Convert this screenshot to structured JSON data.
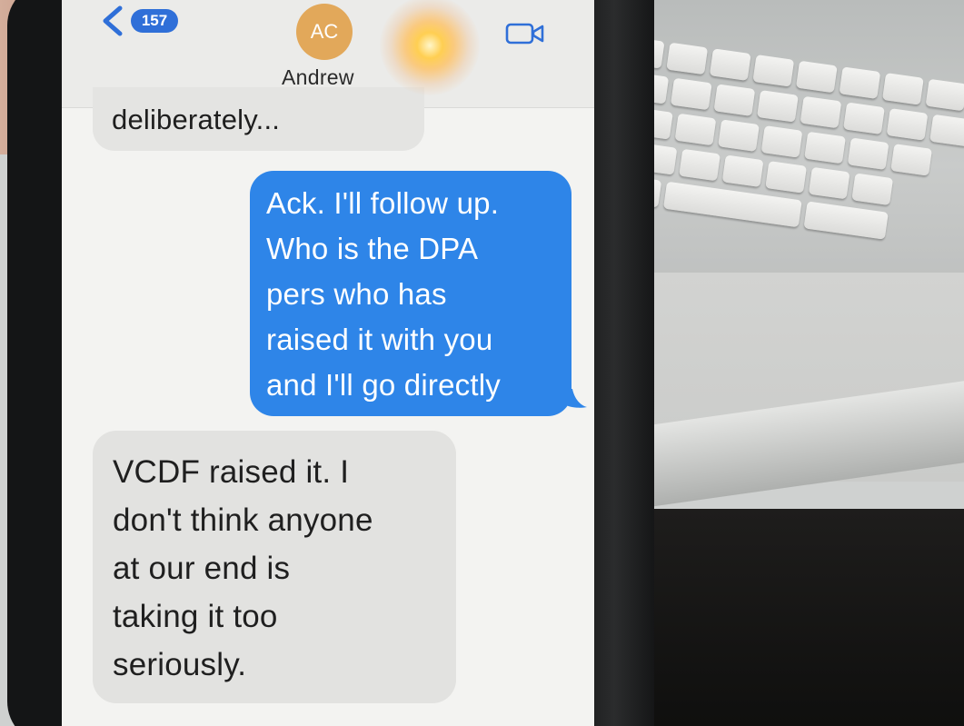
{
  "header": {
    "back_count": "157",
    "avatar_initials": "AC",
    "contact_name": "Andrew"
  },
  "messages": [
    {
      "direction": "incoming",
      "lines": [
        "deliberately..."
      ]
    },
    {
      "direction": "outgoing",
      "lines": [
        "Ack. I'll follow up.",
        "Who is the DPA",
        "pers who has",
        "raised it with you",
        "and I'll go directly"
      ]
    },
    {
      "direction": "incoming",
      "lines": [
        "VCDF raised it. I",
        "don't think anyone",
        "at our end is",
        "taking it too",
        "seriously."
      ]
    }
  ],
  "colors": {
    "outgoing_bubble": "#2e85e8",
    "incoming_bubble": "#e2e2e0",
    "badge": "#2f6fd8",
    "avatar": "#e2a85a"
  },
  "icons": [
    "back-chevron-icon",
    "video-camera-icon"
  ]
}
